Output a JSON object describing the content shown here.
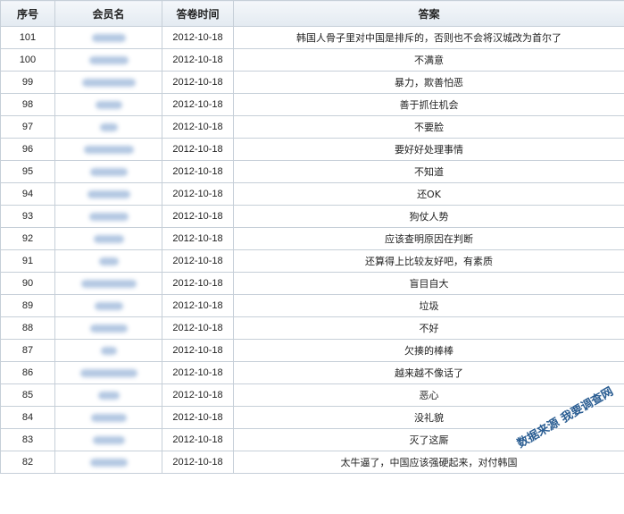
{
  "headers": [
    "序号",
    "会员名",
    "答卷时间",
    "答案"
  ],
  "rows": [
    {
      "id": "101",
      "date": "2012-10-18",
      "answer": "韩国人骨子里对中国是排斥的，否则也不会将汉城改为首尔了"
    },
    {
      "id": "100",
      "date": "2012-10-18",
      "answer": "不满意"
    },
    {
      "id": "99",
      "date": "2012-10-18",
      "answer": "暴力，欺善怕恶"
    },
    {
      "id": "98",
      "date": "2012-10-18",
      "answer": "善于抓住机会"
    },
    {
      "id": "97",
      "date": "2012-10-18",
      "answer": "不要脸"
    },
    {
      "id": "96",
      "date": "2012-10-18",
      "answer": "要好好处理事情"
    },
    {
      "id": "95",
      "date": "2012-10-18",
      "answer": "不知道"
    },
    {
      "id": "94",
      "date": "2012-10-18",
      "answer": "还OK"
    },
    {
      "id": "93",
      "date": "2012-10-18",
      "answer": "狗仗人势"
    },
    {
      "id": "92",
      "date": "2012-10-18",
      "answer": "应该查明原因在判断"
    },
    {
      "id": "91",
      "date": "2012-10-18",
      "answer": "还算得上比较友好吧，有素质"
    },
    {
      "id": "90",
      "date": "2012-10-18",
      "answer": "盲目自大"
    },
    {
      "id": "89",
      "date": "2012-10-18",
      "answer": "垃圾"
    },
    {
      "id": "88",
      "date": "2012-10-18",
      "answer": "不好"
    },
    {
      "id": "87",
      "date": "2012-10-18",
      "answer": "欠揍的棒棒"
    },
    {
      "id": "86",
      "date": "2012-10-18",
      "answer": "越来越不像话了"
    },
    {
      "id": "85",
      "date": "2012-10-18",
      "answer": "恶心"
    },
    {
      "id": "84",
      "date": "2012-10-18",
      "answer": "没礼貌"
    },
    {
      "id": "83",
      "date": "2012-10-18",
      "answer": "灭了这厮"
    },
    {
      "id": "82",
      "date": "2012-10-18",
      "answer": "太牛逼了，中国应该强硬起来，对付韩国"
    }
  ],
  "watermark": "数据来源 我要调查网"
}
